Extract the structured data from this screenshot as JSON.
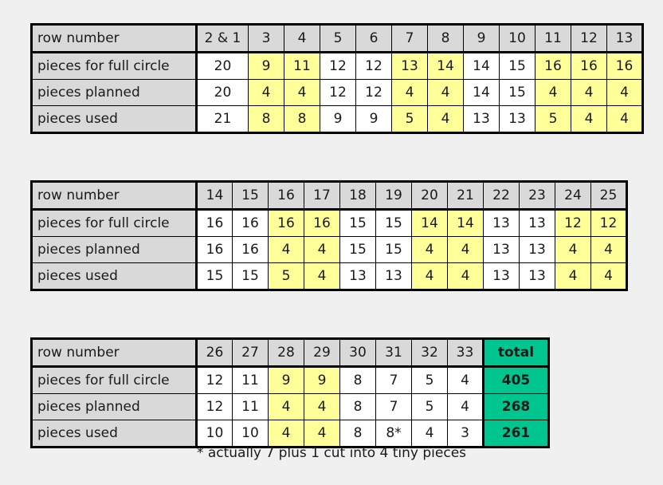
{
  "colors": {
    "background": "#f0f0f0",
    "header_fill": "#d9d9d9",
    "label_fill": "#d9d9d9",
    "highlight": "#ffff99",
    "total_fill": "#00c58e",
    "border": "#000000",
    "text": "#1a1a1a"
  },
  "row_labels": {
    "row_number": "row number",
    "pieces_for_full_circle": "pieces for full circle",
    "pieces_planned": "pieces planned",
    "pieces_used": "pieces used"
  },
  "footnote": "* actually 7 plus 1 cut into 4 tiny pieces",
  "total_header": "total",
  "chart_data": {
    "type": "table",
    "title": "",
    "row_headers": [
      "row number",
      "pieces for full circle",
      "pieces planned",
      "pieces used"
    ],
    "tables": [
      {
        "id": "table-1",
        "columns": [
          "2 & 1",
          "3",
          "4",
          "5",
          "6",
          "7",
          "8",
          "9",
          "10",
          "11",
          "12",
          "13"
        ],
        "highlight": [
          false,
          true,
          true,
          false,
          false,
          true,
          true,
          false,
          false,
          true,
          true,
          true
        ],
        "rows": [
          {
            "label": "pieces for full circle",
            "values": [
              "20",
              "9",
              "11",
              "12",
              "12",
              "13",
              "14",
              "14",
              "15",
              "16",
              "16",
              "16"
            ]
          },
          {
            "label": "pieces planned",
            "values": [
              "20",
              "4",
              "4",
              "12",
              "12",
              "4",
              "4",
              "14",
              "15",
              "4",
              "4",
              "4"
            ]
          },
          {
            "label": "pieces used",
            "values": [
              "21",
              "8",
              "8",
              "9",
              "9",
              "5",
              "4",
              "13",
              "13",
              "5",
              "4",
              "4"
            ]
          }
        ]
      },
      {
        "id": "table-2",
        "columns": [
          "14",
          "15",
          "16",
          "17",
          "18",
          "19",
          "20",
          "21",
          "22",
          "23",
          "24",
          "25"
        ],
        "highlight": [
          false,
          false,
          true,
          true,
          false,
          false,
          true,
          true,
          false,
          false,
          true,
          true
        ],
        "rows": [
          {
            "label": "pieces for full circle",
            "values": [
              "16",
              "16",
              "16",
              "16",
              "15",
              "15",
              "14",
              "14",
              "13",
              "13",
              "12",
              "12"
            ]
          },
          {
            "label": "pieces planned",
            "values": [
              "16",
              "16",
              "4",
              "4",
              "15",
              "15",
              "4",
              "4",
              "13",
              "13",
              "4",
              "4"
            ]
          },
          {
            "label": "pieces used",
            "values": [
              "15",
              "15",
              "5",
              "4",
              "13",
              "13",
              "4",
              "4",
              "13",
              "13",
              "4",
              "4"
            ]
          }
        ]
      },
      {
        "id": "table-3",
        "columns": [
          "26",
          "27",
          "28",
          "29",
          "30",
          "31",
          "32",
          "33"
        ],
        "highlight": [
          false,
          false,
          true,
          true,
          false,
          false,
          false,
          false
        ],
        "total_column": "total",
        "rows": [
          {
            "label": "pieces for full circle",
            "values": [
              "12",
              "11",
              "9",
              "9",
              "8",
              "7",
              "5",
              "4"
            ],
            "total": "405"
          },
          {
            "label": "pieces planned",
            "values": [
              "12",
              "11",
              "4",
              "4",
              "8",
              "7",
              "5",
              "4"
            ],
            "total": "268"
          },
          {
            "label": "pieces used",
            "values": [
              "10",
              "10",
              "4",
              "4",
              "8",
              "8*",
              "4",
              "3"
            ],
            "total": "261"
          }
        ]
      }
    ]
  }
}
